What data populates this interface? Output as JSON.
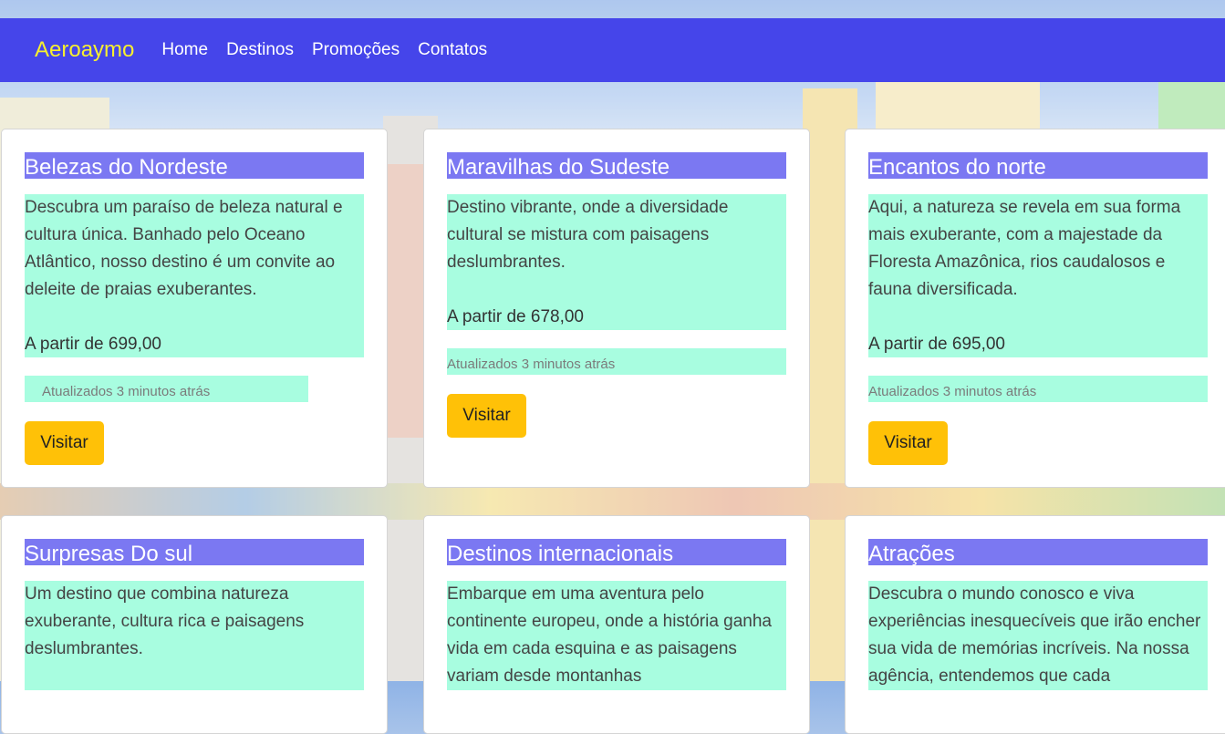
{
  "nav": {
    "brand": "Aeroaymo",
    "links": [
      "Home",
      "Destinos",
      "Promoções",
      "Contatos"
    ]
  },
  "cards": [
    {
      "title": "Belezas do Nordeste",
      "text": "Descubra um paraíso de beleza natural e cultura única. Banhado pelo Oceano Atlântico, nosso destino é um convite ao deleite de praias exuberantes.",
      "price": "A partir de 699,00",
      "updated": "Atualizados 3 minutos atrás",
      "button": "Visitar"
    },
    {
      "title": "Maravilhas do Sudeste",
      "text": "Destino vibrante, onde a diversidade cultural se mistura com paisagens deslumbrantes.",
      "price": "A partir de 678,00",
      "updated": "Atualizados 3 minutos atrás",
      "button": "Visitar"
    },
    {
      "title": "Encantos do norte",
      "text": "Aqui, a natureza se revela em sua forma mais exuberante, com a majestade da Floresta Amazônica, rios caudalosos e fauna diversificada.",
      "price": "A partir de 695,00",
      "updated": "Atualizados 3 minutos atrás",
      "button": "Visitar"
    },
    {
      "title": "Surpresas Do sul",
      "text": "Um destino que combina natureza exuberante, cultura rica e paisagens deslumbrantes."
    },
    {
      "title": "Destinos internacionais",
      "text": "Embarque em uma aventura pelo continente europeu, onde a história ganha vida em cada esquina e as paisagens variam desde montanhas"
    },
    {
      "title": "Atrações",
      "text": "Descubra o mundo conosco e viva experiências inesquecíveis que irão encher sua vida de memórias incríveis. Na nossa agência, entendemos que cada"
    }
  ]
}
